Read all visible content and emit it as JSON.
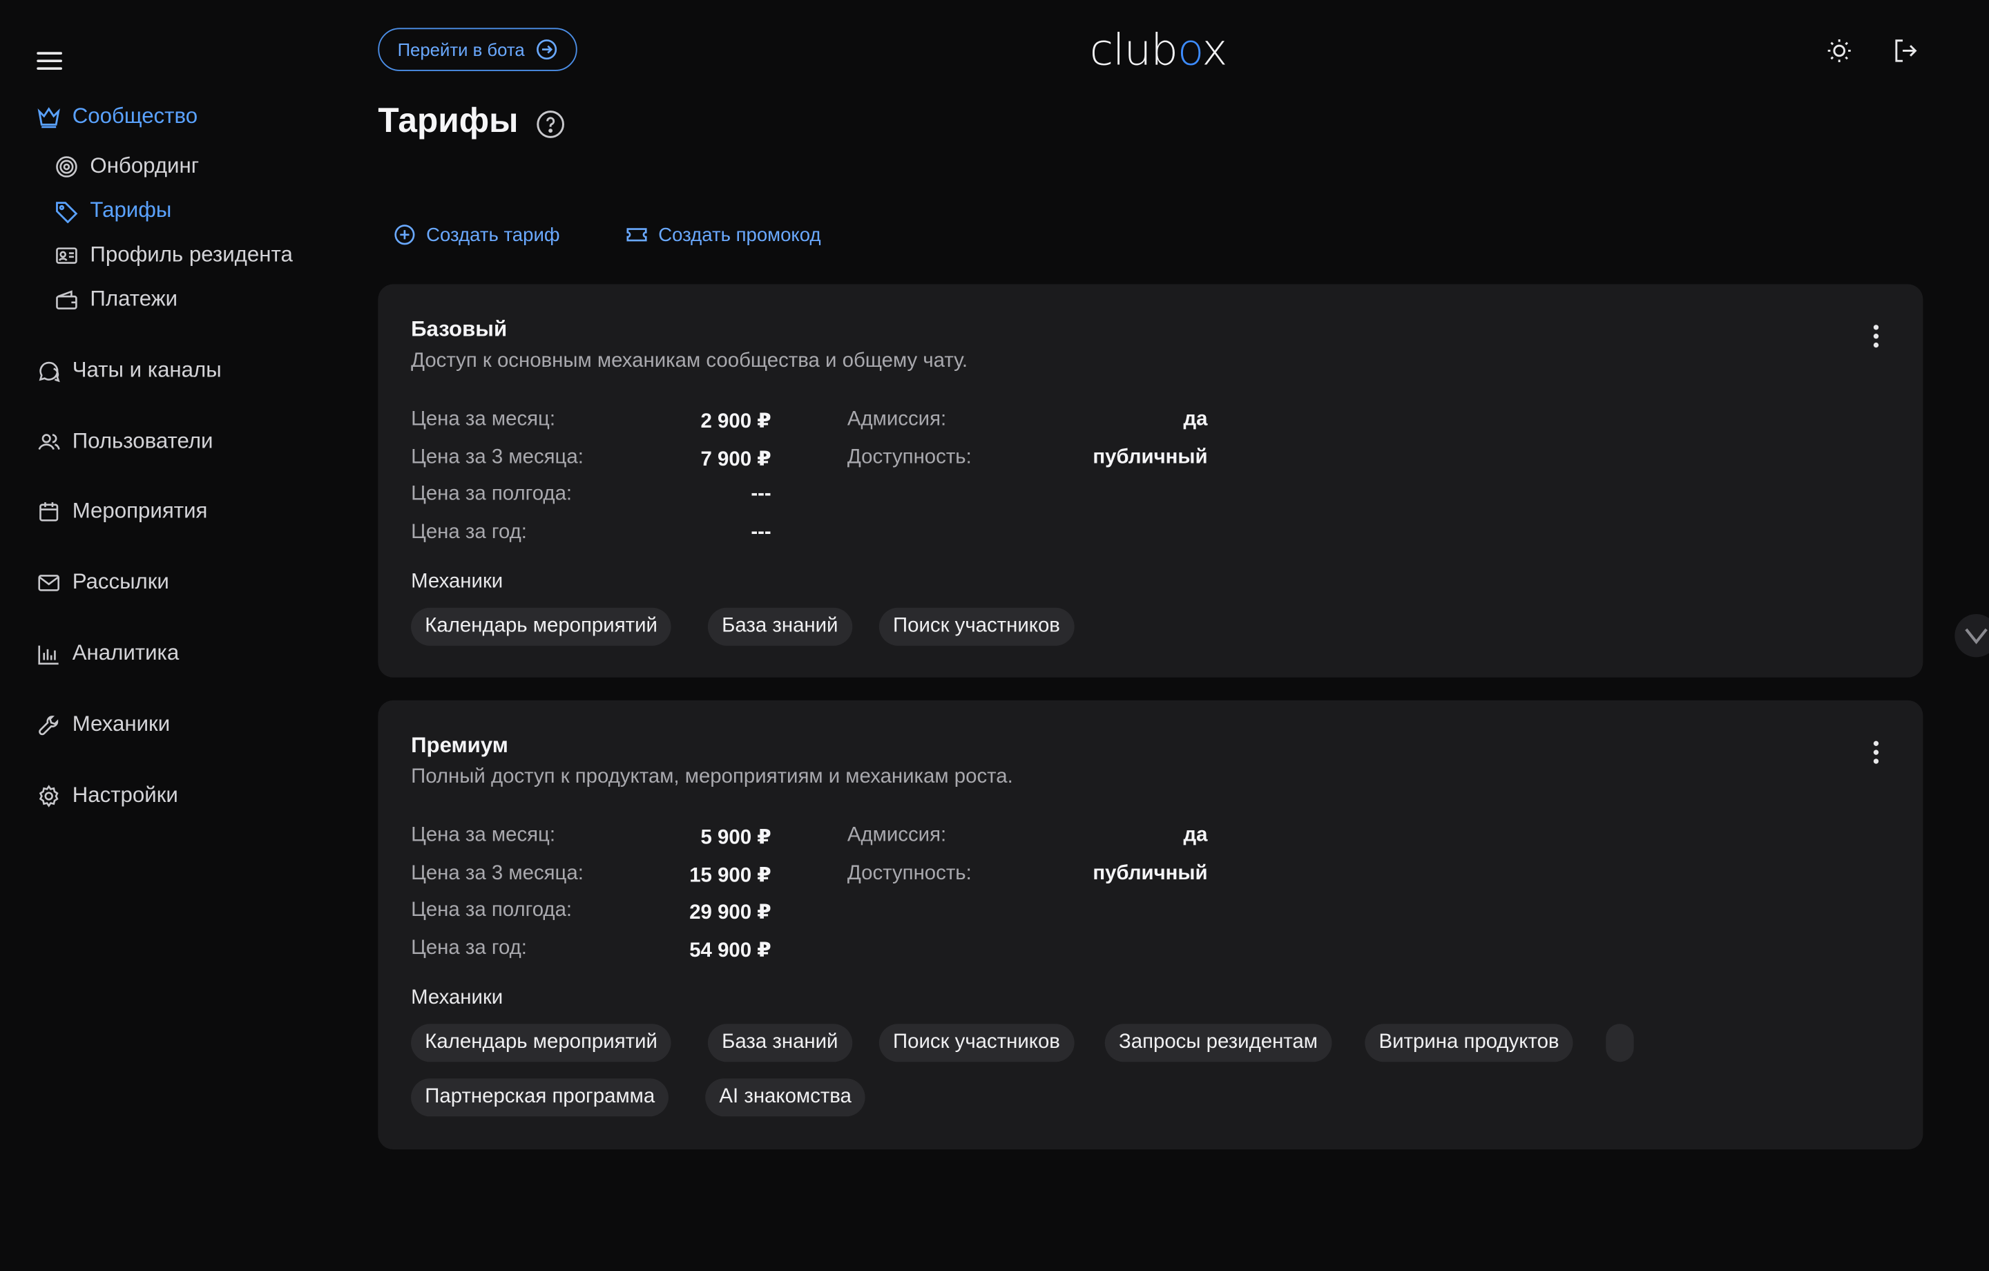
{
  "sidebar": {
    "items": [
      {
        "label": "Сообщество",
        "icon": "crown-icon",
        "active": true
      },
      {
        "label": "Онбординг",
        "icon": "target-icon",
        "sub": true
      },
      {
        "label": "Тарифы",
        "icon": "tag-icon",
        "sub": true,
        "active": true
      },
      {
        "label": "Профиль резидента",
        "icon": "id-card-icon",
        "sub": true
      },
      {
        "label": "Платежи",
        "icon": "wallet-icon",
        "sub": true
      },
      {
        "label": "Чаты и каналы",
        "icon": "chat-icon"
      },
      {
        "label": "Пользователи",
        "icon": "users-icon"
      },
      {
        "label": "Мероприятия",
        "icon": "calendar-icon"
      },
      {
        "label": "Рассылки",
        "icon": "mail-icon"
      },
      {
        "label": "Аналитика",
        "icon": "bar-chart-icon"
      },
      {
        "label": "Механики",
        "icon": "wrench-icon"
      },
      {
        "label": "Настройки",
        "icon": "gear-icon"
      }
    ]
  },
  "header": {
    "bot_button": "Перейти в бота",
    "logo": {
      "pre": "club",
      "o": "o",
      "post": "x"
    },
    "page_title": "Тарифы"
  },
  "actions": {
    "create_tariff": "Создать тариф",
    "create_promo": "Создать промокод"
  },
  "labels": {
    "price_month": "Цена за месяц:",
    "price_3months": "Цена за 3 месяца:",
    "price_half": "Цена за полгода:",
    "price_year": "Цена за год:",
    "admission": "Адмиссия:",
    "availability": "Доступность:",
    "mechanics": "Механики"
  },
  "tariffs": [
    {
      "name": "Базовый",
      "description": "Доступ к основным механикам сообщества и общему чату.",
      "price_month": "2 900 ₽",
      "price_3months": "7 900 ₽",
      "price_half": "---",
      "price_year": "---",
      "admission": "да",
      "availability": "публичный",
      "mechanics": [
        "Календарь мероприятий",
        "База знаний",
        "Поиск участников"
      ]
    },
    {
      "name": "Премиум",
      "description": "Полный доступ к продуктам, мероприятиям и механикам роста.",
      "price_month": "5 900 ₽",
      "price_3months": "15 900 ₽",
      "price_half": "29 900 ₽",
      "price_year": "54 900 ₽",
      "admission": "да",
      "availability": "публичный",
      "mechanics": [
        "Календарь мероприятий",
        "База знаний",
        "Поиск участников",
        "Запросы резидентам",
        "Витрина продуктов",
        "",
        "Партнерская программа",
        "AI знакомства"
      ]
    }
  ],
  "colors": {
    "accent": "#5aa2ff",
    "background": "#0b0b0c",
    "card": "#1b1b1d",
    "chip": "#2a2a2d"
  }
}
